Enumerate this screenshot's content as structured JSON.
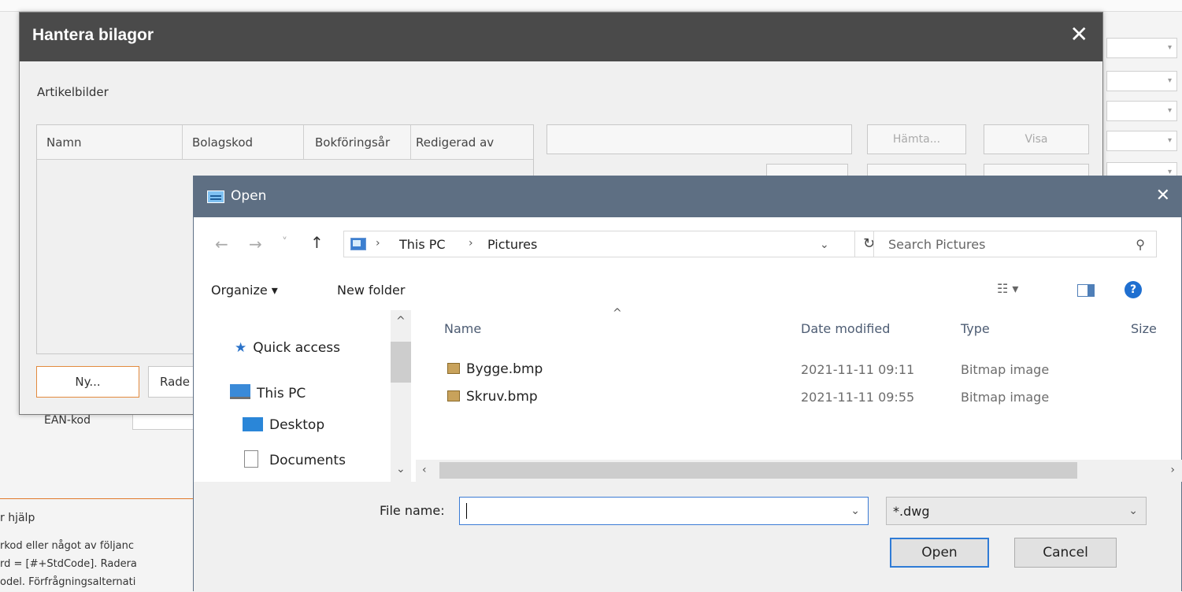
{
  "background": {
    "top_text": "",
    "ean_label": "EAN-kod",
    "help_heading": "r hjälp",
    "help_lines": [
      "rkod eller något av följanc",
      "rd = [#+StdCode]. Radera",
      "odel. Förfrågningsalternati"
    ]
  },
  "attachments_dialog": {
    "title": "Hantera bilagor",
    "close_glyph": "✕",
    "section_label": "Artikelbilder",
    "columns": [
      "Namn",
      "Bolagskod",
      "Bokföringsår",
      "Redigerad av"
    ],
    "fetch_button": "Hämta...",
    "show_button": "Visa",
    "new_button": "Ny...",
    "delete_button": "Rade"
  },
  "open_dialog": {
    "title": "Open",
    "close_glyph": "✕",
    "nav": {
      "back": "←",
      "forward": "→",
      "recent": "˅",
      "up": "↑"
    },
    "breadcrumb": [
      "This PC",
      "Pictures"
    ],
    "breadcrumb_sep": "›",
    "search_placeholder": "Search Pictures",
    "toolbar": {
      "organize": "Organize ▾",
      "new_folder": "New folder"
    },
    "nav_pane": [
      "Quick access",
      "This PC",
      "Desktop",
      "Documents"
    ],
    "columns": {
      "name": "Name",
      "date": "Date modified",
      "type": "Type",
      "size": "Size"
    },
    "files": [
      {
        "name": "Bygge.bmp",
        "date": "2021-11-11 09:11",
        "type": "Bitmap image"
      },
      {
        "name": "Skruv.bmp",
        "date": "2021-11-11 09:55",
        "type": "Bitmap image"
      }
    ],
    "file_name_label": "File name:",
    "file_name_value": "",
    "filter_value": "*.dwg",
    "open_button": "Open",
    "cancel_button": "Cancel"
  }
}
